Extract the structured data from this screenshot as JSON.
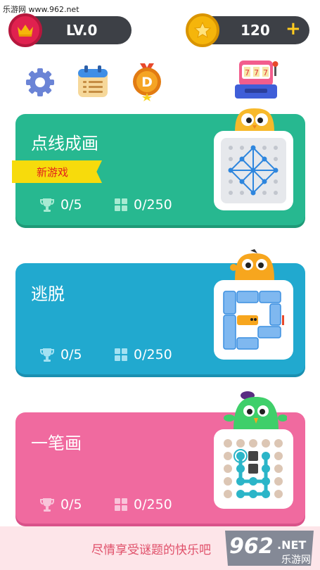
{
  "watermark_top": "乐游网 www.962.net",
  "header": {
    "level": "LV.0",
    "coins": "120",
    "plus": "+"
  },
  "cards": [
    {
      "title": "点线成画",
      "tag": "新游戏",
      "trophies": "0/5",
      "levels": "0/250",
      "color": "#27b890"
    },
    {
      "title": "逃脱",
      "trophies": "0/5",
      "levels": "0/250",
      "color": "#21a9cf"
    },
    {
      "title": "一笔画",
      "trophies": "0/5",
      "levels": "0/250",
      "color": "#f06a9f"
    }
  ],
  "footer": {
    "slogan": "尽情享受谜题的快乐吧",
    "logo_number": "962",
    "logo_suffix": ".NET",
    "logo_sub": "乐游网"
  },
  "icons": [
    "crown-icon",
    "star-coin-icon",
    "settings-gear-icon",
    "calendar-icon",
    "d-medal-icon",
    "slot-machine-icon",
    "trophy-icon",
    "grid-icon"
  ]
}
